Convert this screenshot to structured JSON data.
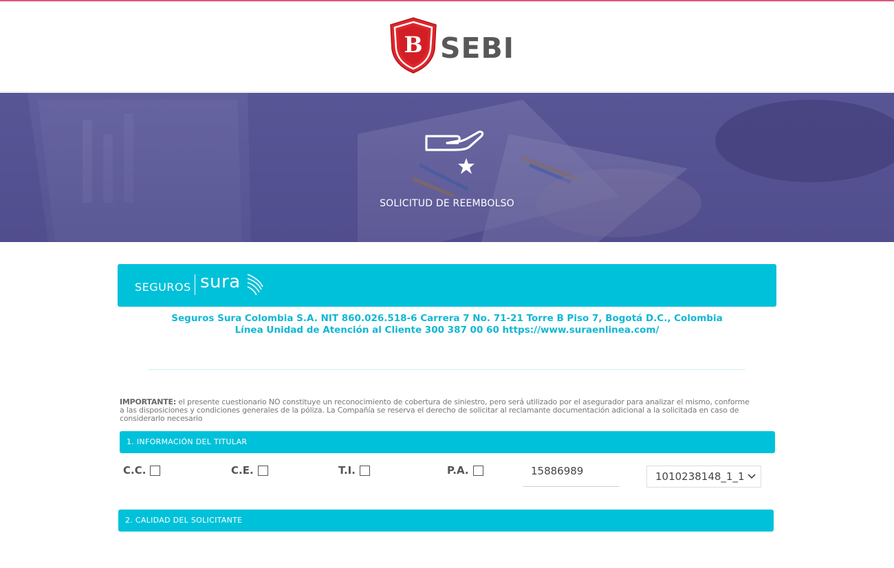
{
  "header": {
    "logo_text": "SEBI",
    "logo_monogram": "B",
    "colors": {
      "shield": "#e0262b",
      "text": "#58585a",
      "top_line": "#e0567a"
    }
  },
  "banner": {
    "icon": "hand-star-icon",
    "title": "SOLICITUD DE REEMBOLSO"
  },
  "brand": {
    "seguros": "SEGUROS",
    "sura": "sura",
    "color": "#00c1da"
  },
  "company_info": {
    "line1": "Seguros Sura Colombia S.A. NIT 860.026.518-6 Carrera 7 No. 71-21 Torre B Piso 7, Bogotá D.C., Colombia",
    "line2": "Línea Unidad de Atención al Cliente 300 387 00 60 https://www.suraenlinea.com/"
  },
  "notice": {
    "label": "IMPORTANTE:",
    "text": " el presente cuestionario NO constituye un reconocimiento de cobertura de siniestro, pero será utilizado por el asegurador para analizar el mismo, conforme a las disposiciones y condiciones generales de la póliza. La Compañía se reserva el derecho de solicitar al reclamante documentación adicional a la solicitada en caso de considerarlo necesario"
  },
  "sections": {
    "titular": "1. INFORMACIÓN DEL TITULAR",
    "calidad": "2. CALIDAD DEL SOLICITANTE"
  },
  "titular": {
    "doc_types": [
      {
        "label": "C.C.",
        "checked": false
      },
      {
        "label": "C.E.",
        "checked": false
      },
      {
        "label": "T.I.",
        "checked": false
      },
      {
        "label": "P.A.",
        "checked": false
      }
    ],
    "id_number": "15886989",
    "policy_select": "1010238148_1_1"
  }
}
